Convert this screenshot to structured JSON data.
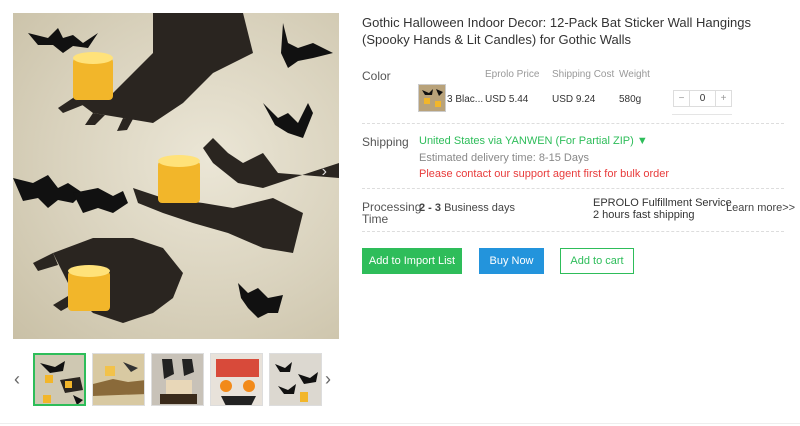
{
  "product": {
    "title": "Gothic Halloween Indoor Decor: 12-Pack Bat Sticker Wall Hangings (Spooky Hands & Lit Candles) for Gothic Walls"
  },
  "gallery": {
    "next_arrow": "›",
    "thumb_prev": "‹",
    "thumb_next": "›",
    "thumbnail_count": 5,
    "active_thumbnail": 1
  },
  "variants": {
    "section_label": "Color",
    "columns": [
      "Eprolo Price",
      "Shipping Cost",
      "Weight"
    ],
    "rows": [
      {
        "name": "3 Blac...",
        "price": "USD 5.44",
        "shipping": "USD 9.24",
        "weight": "580g",
        "quantity": "0"
      }
    ],
    "stepper_minus": "−",
    "stepper_plus": "+"
  },
  "shipping": {
    "label": "Shipping",
    "method": "United States via YANWEN (For Partial ZIP) ▼",
    "estimate": "Estimated delivery time: 8-15 Days",
    "warning": "Please contact our support agent first for bulk order"
  },
  "processing": {
    "label_line1": "Processing",
    "label_line2": "Time",
    "days_bold": "2 - 3",
    "days_rest": " Business days",
    "service_line1": "EPROLO Fulfillment Service",
    "service_line2": "2 hours fast shipping",
    "learn_more": "Learn more>>"
  },
  "actions": {
    "import": "Add to Import List",
    "buy": "Buy Now",
    "cart": "Add to cart"
  },
  "colors": {
    "accent_green": "#2ebd5a",
    "accent_blue": "#2394dc",
    "warning_red": "#e83b3b"
  }
}
